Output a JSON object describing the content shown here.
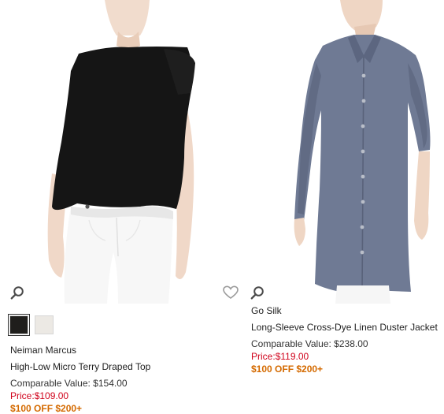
{
  "products": [
    {
      "brand": "Neiman Marcus",
      "name": "High-Low Micro Terry Draped Top",
      "comparable_label": "Comparable Value: ",
      "comparable_value": "$154.00",
      "price_label": "Price:",
      "price_value": "$109.00",
      "promo": "$100 OFF $200+",
      "icons": [
        "search-icon",
        "heart-icon"
      ],
      "swatches": [
        {
          "color": "#1f1e1c",
          "selected": true
        },
        {
          "color": "#ece9e4",
          "selected": false
        }
      ]
    },
    {
      "brand": "Go Silk",
      "name": "Long-Sleeve Cross-Dye Linen Duster Jacket",
      "comparable_label": "Comparable Value: ",
      "comparable_value": "$238.00",
      "price_label": "Price:",
      "price_value": "$119.00",
      "promo": "$100 OFF $200+",
      "icons": [
        "search-icon"
      ]
    }
  ],
  "colors": {
    "price": "#d0021b",
    "promo": "#d46a00",
    "text": "#333333"
  }
}
